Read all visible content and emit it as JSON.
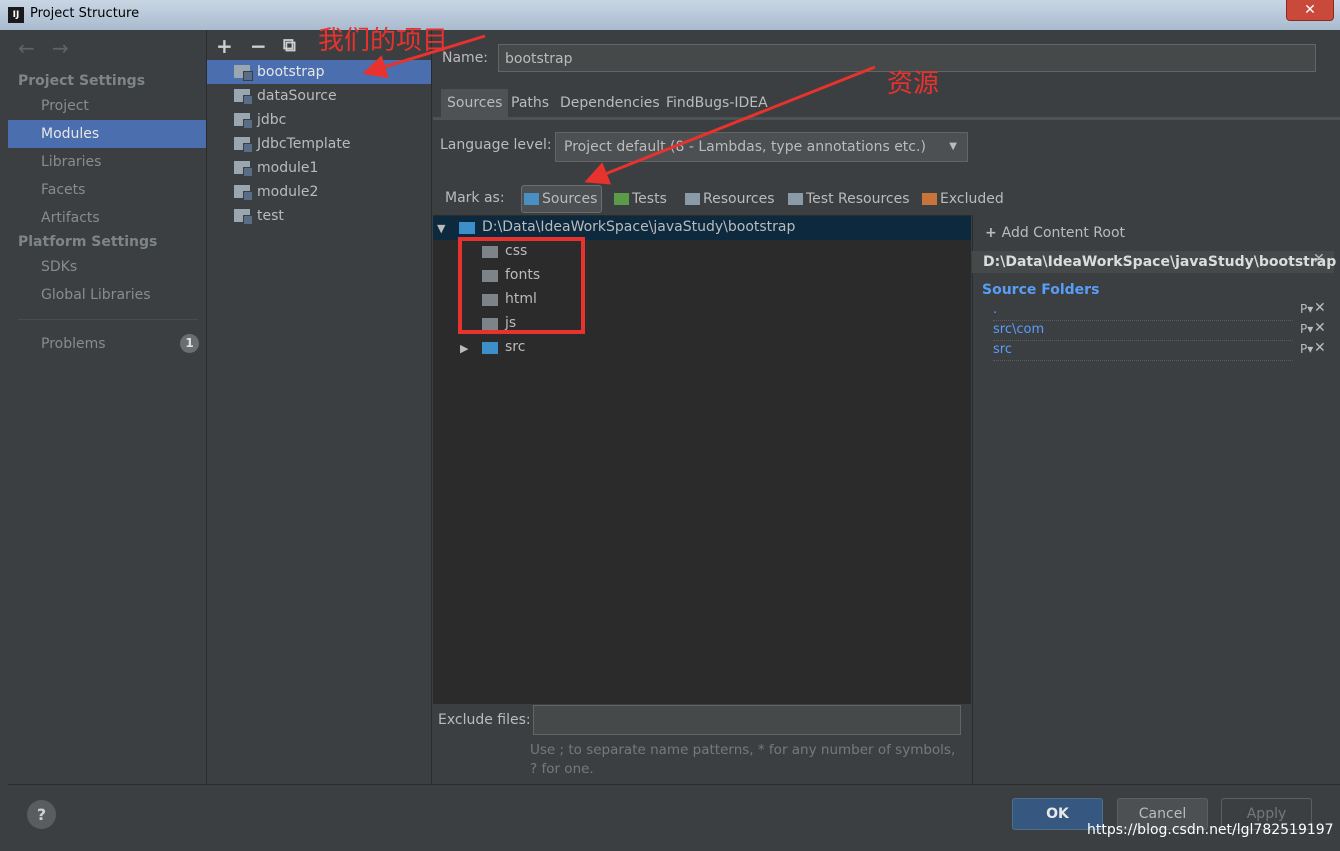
{
  "window": {
    "title": "Project Structure",
    "close_glyph": "✕",
    "app_icon": "IJ"
  },
  "nav": {
    "back_icon": "←",
    "forward_icon": "→",
    "project_settings_header": "Project Settings",
    "platform_settings_header": "Platform Settings",
    "items": [
      "Project",
      "Modules",
      "Libraries",
      "Facets",
      "Artifacts"
    ],
    "platform_items": [
      "SDKs",
      "Global Libraries"
    ],
    "problems_label": "Problems",
    "problems_count": "1",
    "selected": "Modules"
  },
  "toolbar": {
    "add": "+",
    "remove": "−",
    "copy": "⧉"
  },
  "modules": [
    "bootstrap",
    "dataSource",
    "jdbc",
    "JdbcTemplate",
    "module1",
    "module2",
    "test"
  ],
  "selected_module": "bootstrap",
  "form": {
    "name_label": "Name:",
    "name_value": "bootstrap",
    "tabs": [
      "Sources",
      "Paths",
      "Dependencies",
      "FindBugs-IDEA"
    ],
    "language_level_label": "Language level:",
    "language_level_value": "Project default (8 - Lambdas, type annotations etc.)",
    "mark_as_label": "Mark as:",
    "mark_options": [
      {
        "label": "Sources",
        "color": "#4a8fc2"
      },
      {
        "label": "Tests",
        "color": "#5a9a48"
      },
      {
        "label": "Resources",
        "color": "#8a9aa6"
      },
      {
        "label": "Test Resources",
        "color": "#8a9aa6"
      },
      {
        "label": "Excluded",
        "color": "#c8733a"
      }
    ],
    "exclude_files_label": "Exclude files:",
    "exclude_files_hint": "Use ; to separate name patterns, * for any number of symbols, ? for one."
  },
  "tree": {
    "root": "D:\\Data\\IdeaWorkSpace\\javaStudy\\bootstrap",
    "children": [
      "css",
      "fonts",
      "html",
      "js"
    ],
    "collapsed_child": "src"
  },
  "content_root": {
    "add_label": "Add Content Root",
    "path": "D:\\Data\\IdeaWorkSpace\\javaStudy\\bootstrap",
    "source_folders_header": "Source Folders",
    "source_folders": [
      ".",
      "src\\com",
      "src"
    ]
  },
  "buttons": {
    "help": "?",
    "ok": "OK",
    "cancel": "Cancel",
    "apply": "Apply"
  },
  "annotations": {
    "project_note": "我们的项目",
    "resource_note": "资源",
    "color": "#e8322e"
  },
  "watermark": "https://blog.csdn.net/lgl782519197"
}
